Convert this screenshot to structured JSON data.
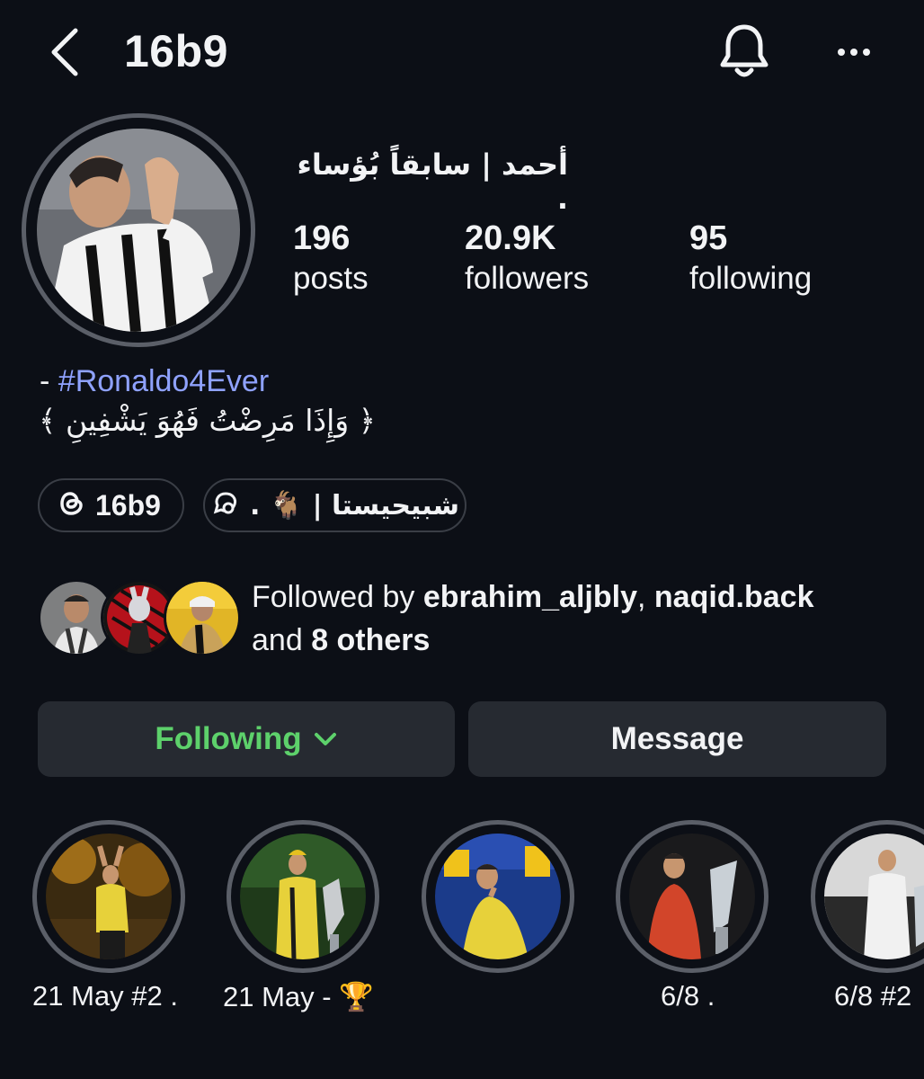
{
  "header": {
    "username": "16b9",
    "back_icon": "chevron-left-icon",
    "bell_icon": "bell-icon",
    "more_icon": "more-horizontal-icon"
  },
  "profile": {
    "display_name": "أحمد | سابقاً بُؤساء .",
    "stats": {
      "posts_count": "196",
      "posts_label": "posts",
      "followers_count": "20.9K",
      "followers_label": "followers",
      "following_count": "95",
      "following_label": "following"
    },
    "bio": {
      "prefix": "- ",
      "hashtag": "#Ronaldo4Ever",
      "line2": "﴿ وَإِذَا مَرِضْتُ فَهُوَ يَشْفِينِ ﴾"
    },
    "threads_chip": {
      "label": "16b9",
      "icon": "threads-icon"
    },
    "link_chip": {
      "label": "شبيحيستا | 🐐 .",
      "icon": "threads-link-icon"
    }
  },
  "followed_by": {
    "prefix": "Followed by ",
    "user1": "ebrahim_aljbly",
    "separator": ", ",
    "user2": "naqid.back",
    "and_text": "and ",
    "others": "8 others"
  },
  "actions": {
    "following_label": "Following",
    "message_label": "Message",
    "accent_color": "#5dd16b"
  },
  "highlights": [
    {
      "label": "21 May #2 ."
    },
    {
      "label": "21 May - 🏆"
    },
    {
      "label": ""
    },
    {
      "label": "6/8 ."
    },
    {
      "label": "6/8 #2"
    }
  ]
}
